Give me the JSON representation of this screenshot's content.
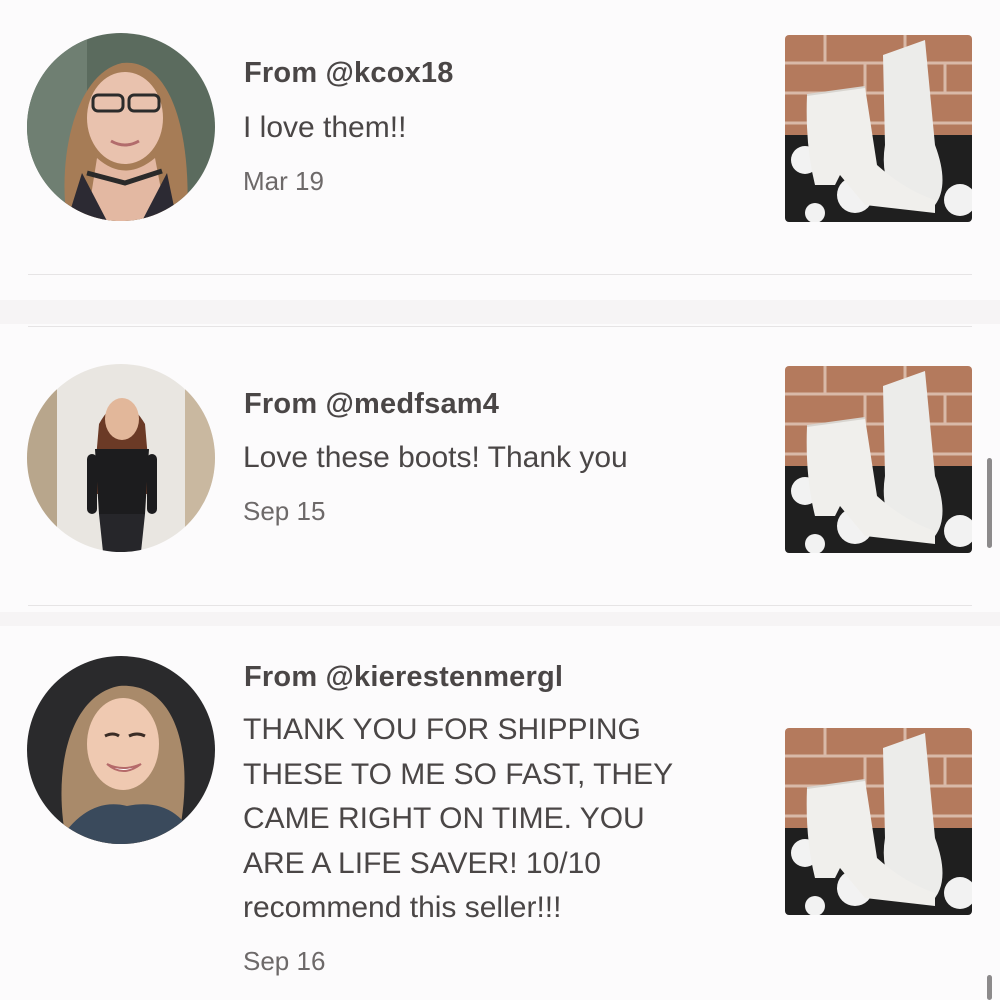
{
  "reviews": [
    {
      "from": "From @kcox18",
      "message": [
        "I love them!!"
      ],
      "date": "Mar 19",
      "avatar_icon": "user-photo-avatar",
      "product_icon": "white-ankle-boots-photo"
    },
    {
      "from": "From @medfsam4",
      "message": [
        "Love these boots! Thank you"
      ],
      "date": "Sep 15",
      "avatar_icon": "user-photo-avatar",
      "product_icon": "white-ankle-boots-photo"
    },
    {
      "from": "From @kierestenmergl",
      "message": [
        "THANK YOU FOR SHIPPING",
        "THESE TO ME SO FAST, THEY",
        "CAME RIGHT ON TIME. YOU",
        "ARE A LIFE SAVER! 10/10",
        "recommend this seller!!!"
      ],
      "date": "Sep 16",
      "avatar_icon": "user-photo-avatar",
      "product_icon": "white-ankle-boots-photo"
    }
  ],
  "colors": {
    "background": "#fcfbfc",
    "text": "#4a4646",
    "muted": "#6d6969",
    "divider": "#e6e4e5"
  }
}
